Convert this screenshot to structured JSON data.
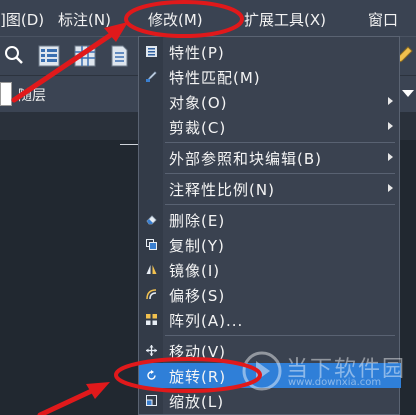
{
  "menubar": {
    "items": [
      "]图(D)",
      "标注(N)",
      "修改(M)",
      "扩展工具(X)",
      "窗口"
    ]
  },
  "layer": {
    "name": "随层"
  },
  "modify_menu": {
    "items": [
      {
        "label": "特性(P)",
        "icon": "properties-icon",
        "submenu": false
      },
      {
        "label": "特性匹配(M)",
        "icon": "match-brush-icon",
        "submenu": false
      },
      {
        "label": "对象(O)",
        "icon": "",
        "submenu": true
      },
      {
        "label": "剪裁(C)",
        "icon": "",
        "submenu": true
      },
      {
        "label": "外部参照和块编辑(B)",
        "icon": "",
        "submenu": true
      },
      {
        "label": "注释性比例(N)",
        "icon": "",
        "submenu": true
      },
      {
        "label": "删除(E)",
        "icon": "eraser-icon",
        "submenu": false
      },
      {
        "label": "复制(Y)",
        "icon": "copy-icon",
        "submenu": false
      },
      {
        "label": "镜像(I)",
        "icon": "mirror-icon",
        "submenu": false
      },
      {
        "label": "偏移(S)",
        "icon": "offset-icon",
        "submenu": false
      },
      {
        "label": "阵列(A)...",
        "icon": "array-icon",
        "submenu": false
      },
      {
        "label": "移动(V)",
        "icon": "move-icon",
        "submenu": false
      },
      {
        "label": "旋转(R)",
        "icon": "rotate-icon",
        "submenu": false,
        "highlighted": true
      },
      {
        "label": "缩放(L)",
        "icon": "scale-icon",
        "submenu": false
      }
    ]
  },
  "watermark": {
    "name": "当下软件园",
    "url": "www.downxia.com"
  },
  "colors": {
    "highlight": "#2f7fd8",
    "annotation_red": "#e0191b",
    "menu_bg": "#3a4250"
  }
}
